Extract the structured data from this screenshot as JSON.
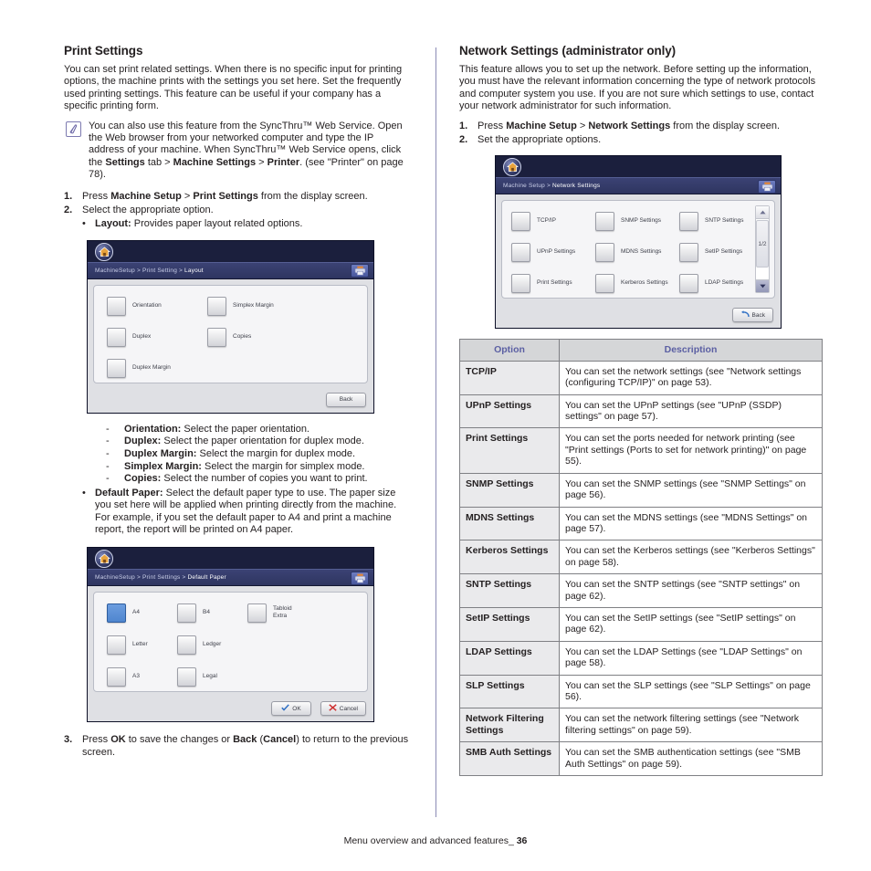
{
  "left": {
    "section_title": "Print Settings",
    "intro": "You can set print related settings. When there is no specific input for printing options, the machine prints with the settings you set here. Set the frequently used printing settings. This feature can be useful if your company has a specific printing form.",
    "note": {
      "icon": "note-pencil-icon",
      "text_parts": [
        {
          "t": "You can also use this feature from the SyncThru™ Web Service. Open the Web browser from your networked computer and type the IP address of your machine. When SyncThru™ Web Service opens, click the ",
          "b": false
        },
        {
          "t": "Settings",
          "b": true
        },
        {
          "t": " tab > ",
          "b": false
        },
        {
          "t": "Machine Settings",
          "b": true
        },
        {
          "t": " > ",
          "b": false
        },
        {
          "t": "Printer",
          "b": true
        },
        {
          "t": ". (see \"Printer\" on page 78).",
          "b": false
        }
      ]
    },
    "steps": [
      {
        "num": "1.",
        "parts": [
          {
            "t": "Press ",
            "b": false
          },
          {
            "t": "Machine Setup",
            "b": true
          },
          {
            "t": " > ",
            "b": false
          },
          {
            "t": "Print Settings",
            "b": true
          },
          {
            "t": " from the display screen.",
            "b": false
          }
        ]
      },
      {
        "num": "2.",
        "parts": [
          {
            "t": "Select the appropriate option.",
            "b": false
          }
        ]
      }
    ],
    "bullet_layout": {
      "dot": "•",
      "parts": [
        {
          "t": "Layout:",
          "b": true
        },
        {
          "t": "  Provides paper layout related options.",
          "b": false
        }
      ]
    },
    "layout_screen": {
      "home_icon": "home-icon",
      "crumb": [
        "MachineSetup",
        "Print Setting"
      ],
      "crumb_current": "Layout",
      "crumb_icon": "printer-icon",
      "tiles": [
        {
          "label": "Orientation",
          "selected": false
        },
        {
          "label": "Simplex Margin",
          "selected": false
        },
        {
          "label": "Duplex",
          "selected": false
        },
        {
          "label": "Copies",
          "selected": false
        },
        {
          "label": "Duplex Margin",
          "selected": false
        }
      ],
      "buttons": [
        {
          "label": "Back",
          "icon": "none"
        }
      ]
    },
    "dash_items": [
      {
        "dot": "-",
        "parts": [
          {
            "t": "Orientation:",
            "b": true
          },
          {
            "t": "  Select the paper orientation.",
            "b": false
          }
        ]
      },
      {
        "dot": "-",
        "parts": [
          {
            "t": "Duplex:",
            "b": true
          },
          {
            "t": "  Select the paper orientation for duplex mode.",
            "b": false
          }
        ]
      },
      {
        "dot": "-",
        "parts": [
          {
            "t": "Duplex Margin:",
            "b": true
          },
          {
            "t": "  Select the margin for duplex mode.",
            "b": false
          }
        ]
      },
      {
        "dot": "-",
        "parts": [
          {
            "t": "Simplex Margin:",
            "b": true
          },
          {
            "t": "  Select the margin for simplex mode.",
            "b": false
          }
        ]
      },
      {
        "dot": "-",
        "parts": [
          {
            "t": "Copies:",
            "b": true
          },
          {
            "t": "  Select the number of copies you want to print.",
            "b": false
          }
        ]
      }
    ],
    "bullet_default_paper": {
      "dot": "•",
      "parts": [
        {
          "t": "Default Paper:",
          "b": true
        },
        {
          "t": "  Select the default paper type to use. The paper size you set here will be applied when printing directly from the machine. For example, if you set the default paper to A4 and print a machine report, the report will be printed on A4 paper.",
          "b": false
        }
      ]
    },
    "default_paper_screen": {
      "home_icon": "home-icon",
      "crumb": [
        "MachineSetup",
        "Print Settings"
      ],
      "crumb_current": "Default Paper",
      "crumb_icon": "printer-icon",
      "tiles": [
        {
          "label": "A4",
          "selected": true
        },
        {
          "label": "B4",
          "selected": false
        },
        {
          "label": "Tabloid\nExtra",
          "selected": false
        },
        {
          "label": "Letter",
          "selected": false
        },
        {
          "label": "Ledger",
          "selected": false
        },
        {
          "label": "A3",
          "selected": false
        },
        {
          "label": "Legal",
          "selected": false
        }
      ],
      "buttons": [
        {
          "label": "OK",
          "icon": "check-icon"
        },
        {
          "label": "Cancel",
          "icon": "x-icon"
        }
      ]
    },
    "step3": {
      "num": "3.",
      "parts": [
        {
          "t": "Press ",
          "b": false
        },
        {
          "t": "OK",
          "b": true
        },
        {
          "t": " to save the changes or ",
          "b": false
        },
        {
          "t": "Back",
          "b": true
        },
        {
          "t": " (",
          "b": false
        },
        {
          "t": "Cancel",
          "b": true
        },
        {
          "t": ") to return to the previous screen.",
          "b": false
        }
      ]
    }
  },
  "right": {
    "section_title": "Network Settings (administrator only)",
    "intro": "This feature allows you to set up the network. Before setting up the information, you must have the relevant information concerning the type of network protocols and computer system you use. If you are not sure which settings to use, contact your network administrator for such information.",
    "steps": [
      {
        "num": "1.",
        "parts": [
          {
            "t": "Press ",
            "b": false
          },
          {
            "t": "Machine Setup",
            "b": true
          },
          {
            "t": " > ",
            "b": false
          },
          {
            "t": "Network Settings",
            "b": true
          },
          {
            "t": " from the display screen.",
            "b": false
          }
        ]
      },
      {
        "num": "2.",
        "parts": [
          {
            "t": "Set the appropriate options.",
            "b": false
          }
        ]
      }
    ],
    "network_screen": {
      "home_icon": "home-icon",
      "crumb": [
        "Machine Setup"
      ],
      "crumb_current": "Network Settings",
      "crumb_icon": "printer-icon",
      "tiles": [
        {
          "label": "TCP/IP",
          "selected": false
        },
        {
          "label": "SNMP Settings",
          "selected": false
        },
        {
          "label": "SNTP Settings",
          "selected": false
        },
        {
          "label": "UPnP Settings",
          "selected": false
        },
        {
          "label": "MDNS Settings",
          "selected": false
        },
        {
          "label": "SetIP Settings",
          "selected": false
        },
        {
          "label": "Print Settings",
          "selected": false
        },
        {
          "label": "Kerberos Settings",
          "selected": false
        },
        {
          "label": "LDAP Settings",
          "selected": false
        }
      ],
      "scroll": {
        "page_indicator": "1/2",
        "up_icon": "scroll-up-arrow-icon",
        "down_icon": "scroll-down-arrow-icon"
      },
      "buttons": [
        {
          "label": "Back",
          "icon": "back-arrow-icon"
        }
      ]
    },
    "table": {
      "headers": [
        "Option",
        "Description"
      ],
      "rows": [
        {
          "option": "TCP/IP",
          "description": "You can set the network settings (see \"Network settings (configuring TCP/IP)\" on page 53)."
        },
        {
          "option": "UPnP Settings",
          "description": "You can set the UPnP settings (see \"UPnP (SSDP) settings\" on page 57)."
        },
        {
          "option": "Print Settings",
          "description": "You can set the ports needed for network printing (see \"Print settings (Ports to set for network printing)\" on page 55)."
        },
        {
          "option": "SNMP Settings",
          "description": "You can set the SNMP settings (see \"SNMP Settings\" on page 56)."
        },
        {
          "option": "MDNS Settings",
          "description": "You can set the MDNS settings (see \"MDNS Settings\" on page 57)."
        },
        {
          "option": "Kerberos Settings",
          "description": "You can set the Kerberos settings (see \"Kerberos Settings\" on page 58)."
        },
        {
          "option": "SNTP Settings",
          "description": "You can set the SNTP settings (see \"SNTP settings\" on page 62)."
        },
        {
          "option": "SetIP Settings",
          "description": "You can set the SetIP settings (see \"SetIP settings\" on page 62)."
        },
        {
          "option": "LDAP Settings",
          "description": "You can set the LDAP Settings (see \"LDAP Settings\" on page 58)."
        },
        {
          "option": "SLP Settings",
          "description": "You can set the SLP settings (see \"SLP Settings\" on page 56)."
        },
        {
          "option": "Network Filtering Settings",
          "description": "You can set the network filtering settings (see \"Network filtering settings\" on page 59)."
        },
        {
          "option": "SMB Auth Settings",
          "description": "You can set the SMB authentication settings (see \"SMB Auth Settings\" on page 59)."
        }
      ]
    }
  },
  "footer": {
    "text": "Menu overview and advanced features",
    "suffix": "_",
    "page": "36"
  },
  "colors": {
    "accent_purple": "#5b5fa3",
    "device_header": "#1b1f3d",
    "device_crumb": "#3b4274",
    "selected_tile": "#4f86cf",
    "divider": "#8b8bb5"
  }
}
